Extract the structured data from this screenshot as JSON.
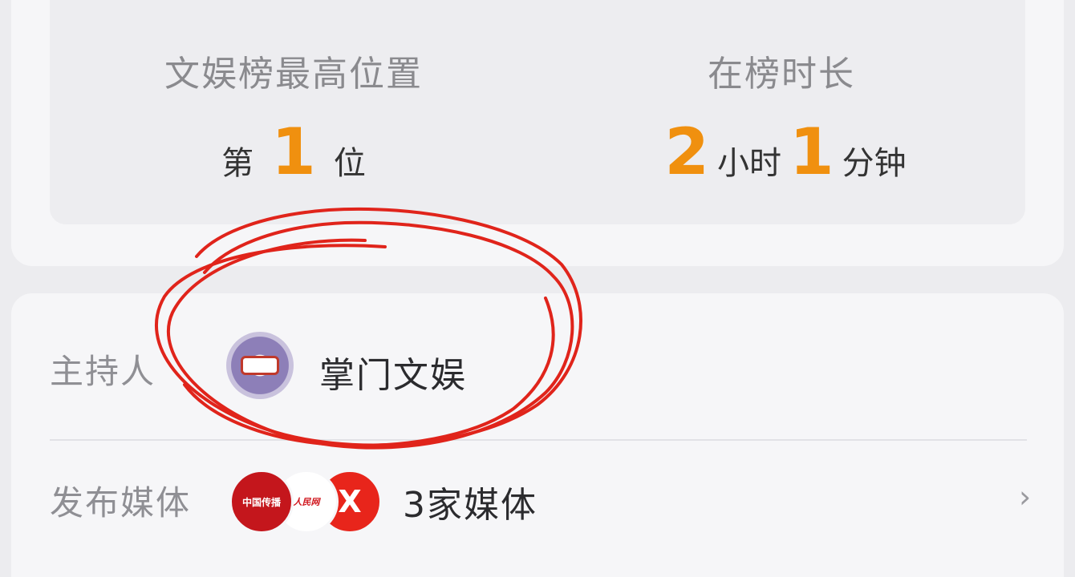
{
  "stats": {
    "rank": {
      "title": "文娱榜最高位置",
      "prefix": "第",
      "value": "1",
      "suffix": "位"
    },
    "duration": {
      "title": "在榜时长",
      "hours": "2",
      "hours_unit": "小时",
      "minutes": "1",
      "minutes_unit": "分钟"
    }
  },
  "info": {
    "host": {
      "label": "主持人",
      "name": "掌门文娱",
      "avatar_icon": "host-avatar"
    },
    "media": {
      "label": "发布媒体",
      "logos": [
        "中国传播",
        "人民网",
        "X"
      ],
      "count_text": "3家媒体",
      "chevron_icon": "chevron-right-icon"
    }
  },
  "colors": {
    "accent_orange": "#f0900f",
    "annotation_red": "#e0241b",
    "card_bg": "#f6f6f8",
    "page_bg": "#ececef"
  }
}
